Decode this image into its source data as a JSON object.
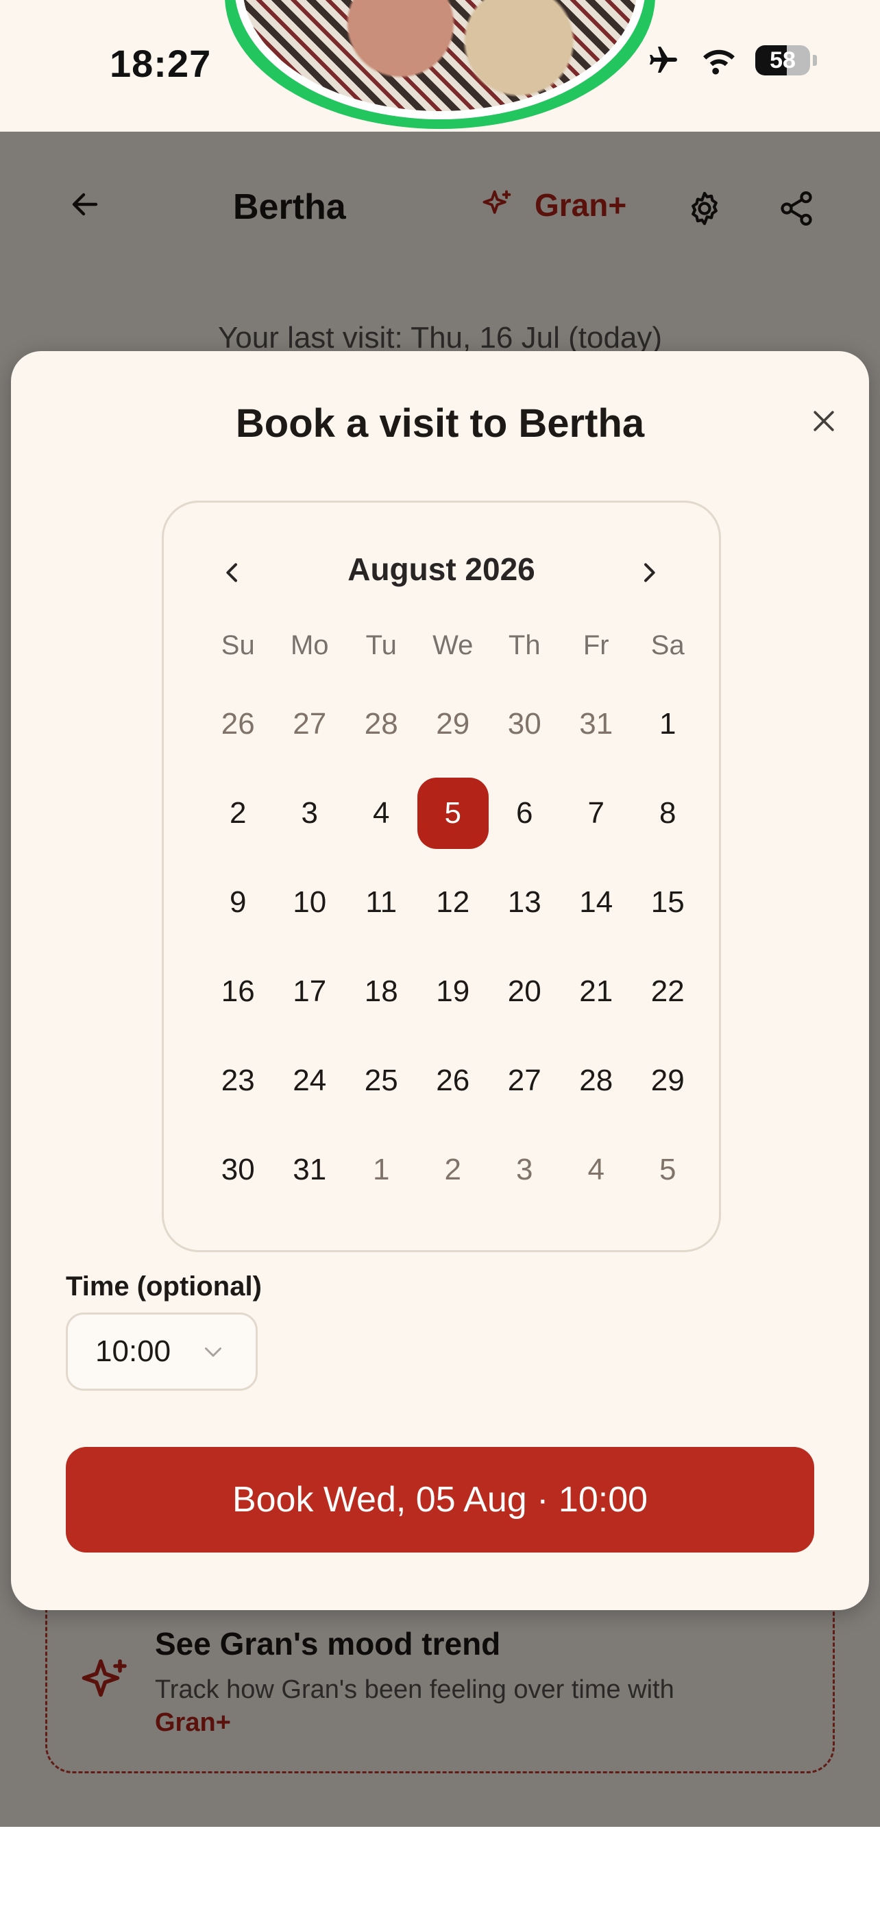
{
  "status_bar": {
    "time": "18:27",
    "battery": "58",
    "battery_level": 0.58
  },
  "header": {
    "title": "Bertha",
    "gran_plus_label": "Gran+"
  },
  "last_visit_text": "Your last visit: Thu, 16 Jul (today)",
  "modal": {
    "title": "Book a visit to Bertha",
    "calendar": {
      "month_label": "August 2026",
      "weekdays": [
        "Su",
        "Mo",
        "Tu",
        "We",
        "Th",
        "Fr",
        "Sa"
      ],
      "days": [
        {
          "label": "26",
          "out": true
        },
        {
          "label": "27",
          "out": true
        },
        {
          "label": "28",
          "out": true
        },
        {
          "label": "29",
          "out": true
        },
        {
          "label": "30",
          "out": true
        },
        {
          "label": "31",
          "out": true
        },
        {
          "label": "1"
        },
        {
          "label": "2"
        },
        {
          "label": "3"
        },
        {
          "label": "4"
        },
        {
          "label": "5",
          "selected": true
        },
        {
          "label": "6"
        },
        {
          "label": "7"
        },
        {
          "label": "8"
        },
        {
          "label": "9"
        },
        {
          "label": "10"
        },
        {
          "label": "11"
        },
        {
          "label": "12"
        },
        {
          "label": "13"
        },
        {
          "label": "14"
        },
        {
          "label": "15"
        },
        {
          "label": "16"
        },
        {
          "label": "17"
        },
        {
          "label": "18"
        },
        {
          "label": "19"
        },
        {
          "label": "20"
        },
        {
          "label": "21"
        },
        {
          "label": "22"
        },
        {
          "label": "23"
        },
        {
          "label": "24"
        },
        {
          "label": "25"
        },
        {
          "label": "26"
        },
        {
          "label": "27"
        },
        {
          "label": "28"
        },
        {
          "label": "29"
        },
        {
          "label": "30"
        },
        {
          "label": "31"
        },
        {
          "label": "1",
          "out": true
        },
        {
          "label": "2",
          "out": true
        },
        {
          "label": "3",
          "out": true
        },
        {
          "label": "4",
          "out": true
        },
        {
          "label": "5",
          "out": true
        }
      ]
    },
    "time_label": "Time (optional)",
    "time_value": "10:00",
    "book_button_label": "Book Wed, 05 Aug · 10:00"
  },
  "mood_card": {
    "title": "See Gran's mood trend",
    "body": "Track how Gran's been feeling over time with",
    "link": "Gran+"
  },
  "colors": {
    "accent": "#b42318",
    "ring": "#22c55e",
    "background": "#fcf6ef"
  },
  "icons": [
    "airplane-icon",
    "wifi-icon",
    "battery-icon",
    "back-arrow-icon",
    "sparkle-icon",
    "gear-icon",
    "share-icon",
    "close-icon",
    "chevron-left-icon",
    "chevron-right-icon",
    "chevron-down-icon"
  ]
}
